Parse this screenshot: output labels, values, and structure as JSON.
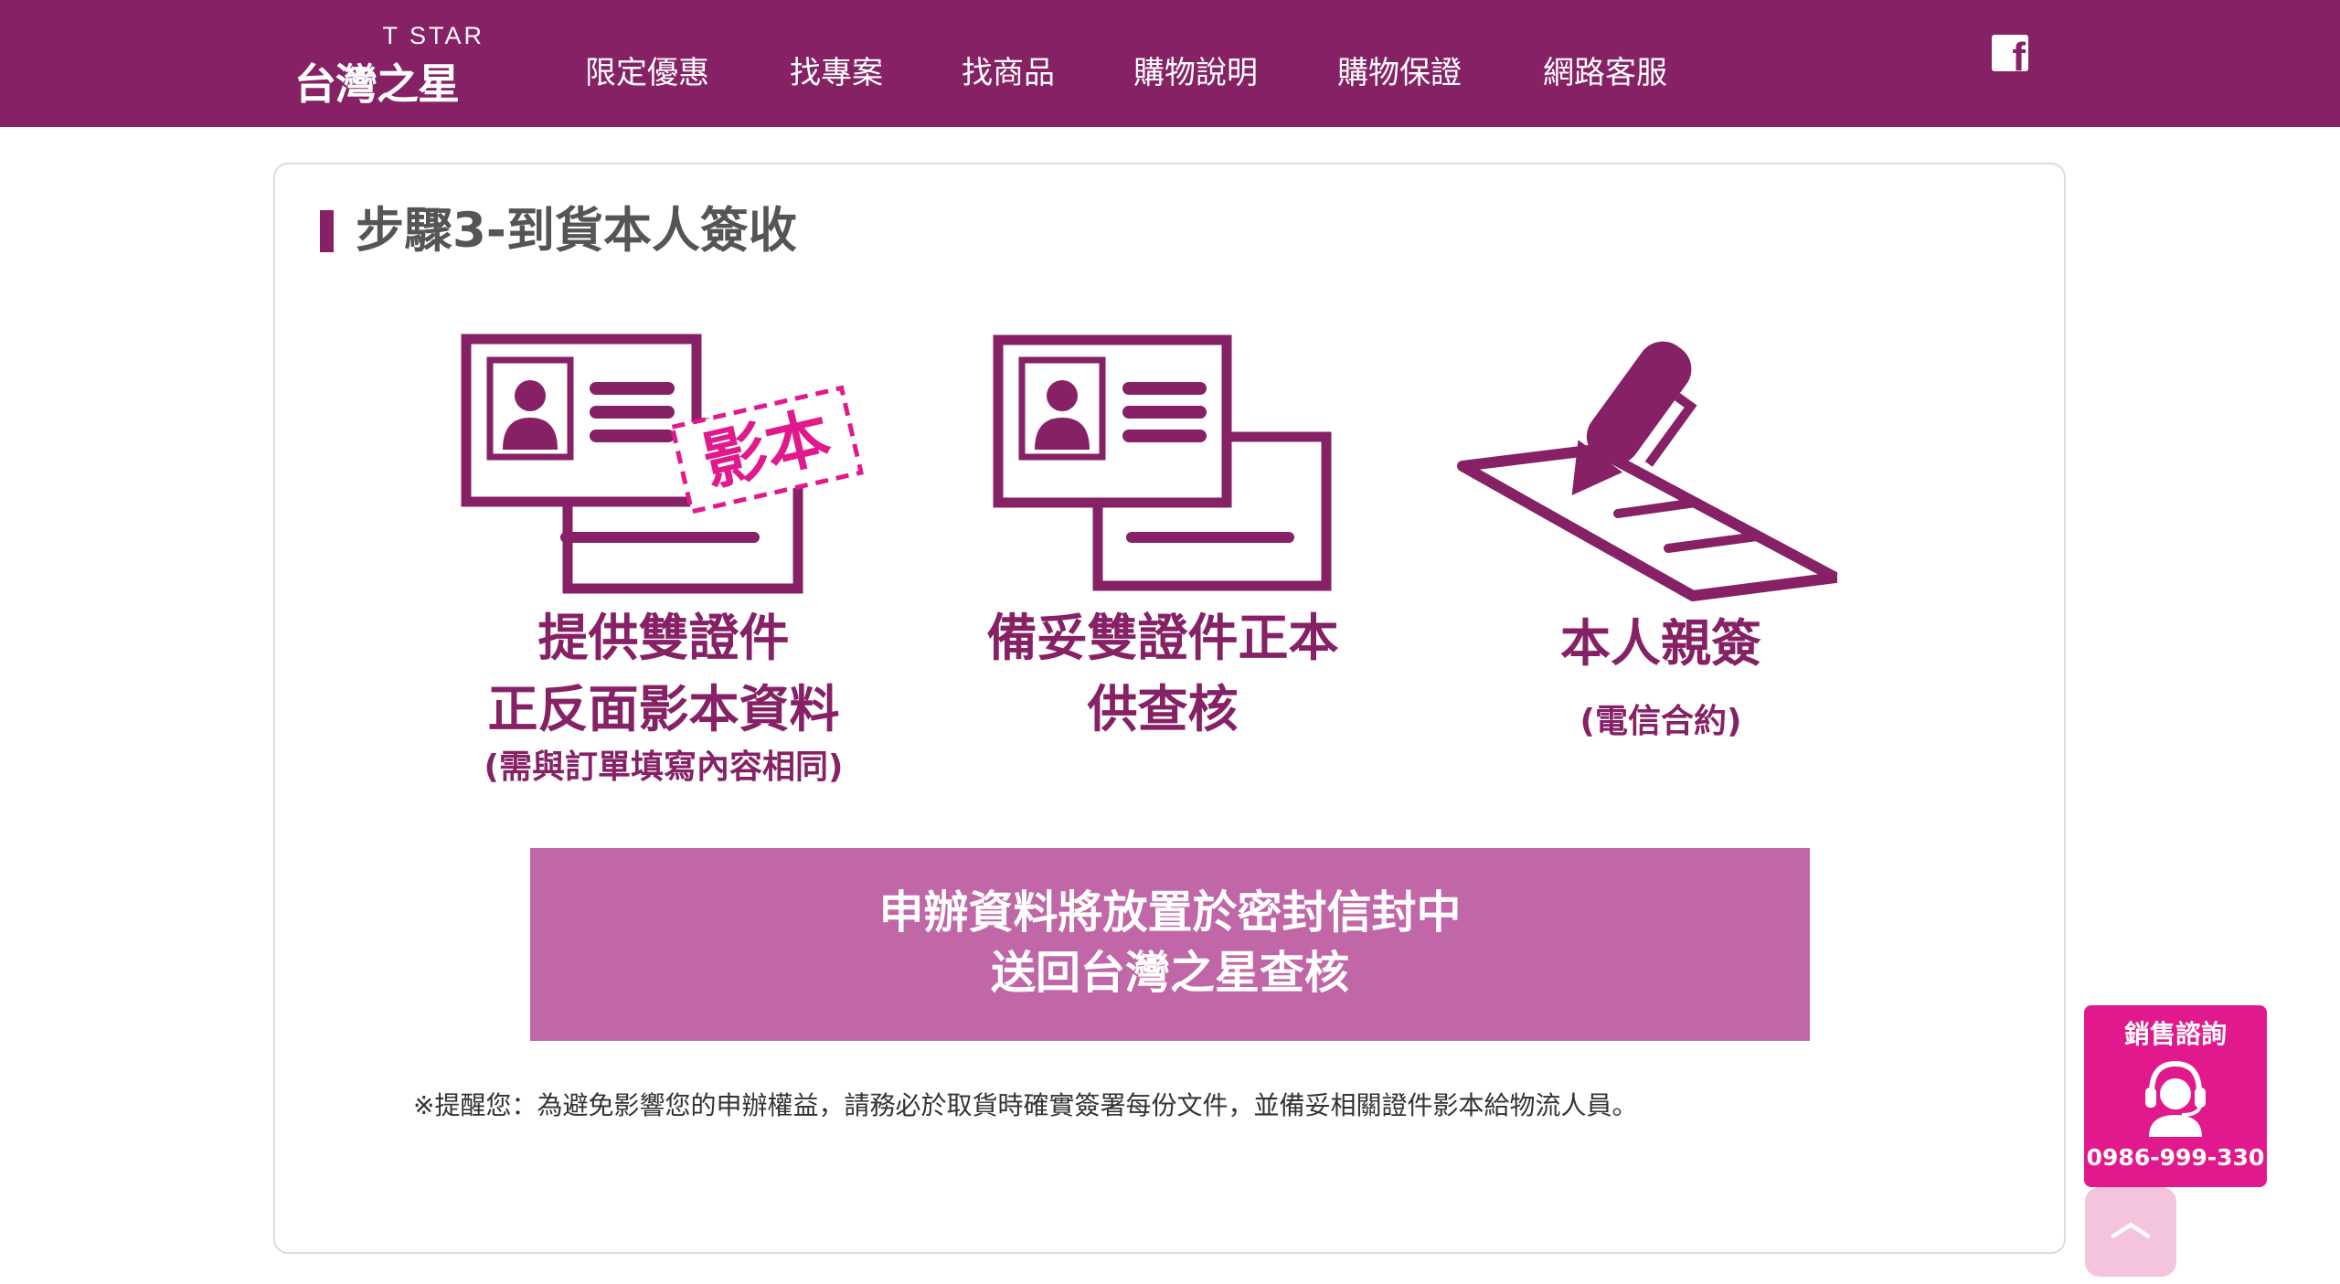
{
  "colors": {
    "brand": "#862166",
    "banner": "#c166a6",
    "accent_pink": "#e2198c",
    "card_border": "#dcdcdc",
    "to_top": "#f4c4dd"
  },
  "header": {
    "logo_small": "T STAR",
    "logo_big": "台灣之星",
    "nav": [
      "限定優惠",
      "找專案",
      "找商品",
      "購物說明",
      "購物保證",
      "網路客服"
    ],
    "facebook_icon": "facebook-icon"
  },
  "section": {
    "title": "步驟3-到貨本人簽收",
    "items": [
      {
        "icon": "id-card-copy-icon",
        "stamp": "影本",
        "title_lines": [
          "提供雙證件",
          "正反面影本資料"
        ],
        "note": "(需與訂單填寫內容相同)"
      },
      {
        "icon": "id-card-original-icon",
        "title_lines": [
          "備妥雙證件正本",
          "供查核"
        ],
        "note": ""
      },
      {
        "icon": "pen-signature-icon",
        "title_lines": [
          "本人親簽"
        ],
        "note": "(電信合約)"
      }
    ],
    "banner_lines": [
      "申辦資料將放置於密封信封中",
      "送回台灣之星查核"
    ],
    "reminder": "※提醒您：為避免影響您的申辦權益，請務必於取貨時確實簽署每份文件，並備妥相關證件影本給物流人員。"
  },
  "floating": {
    "sales_title": "銷售諮詢",
    "sales_icon": "headset-agent-icon",
    "phone": "0986-999-330",
    "to_top_symbol": "︿"
  }
}
